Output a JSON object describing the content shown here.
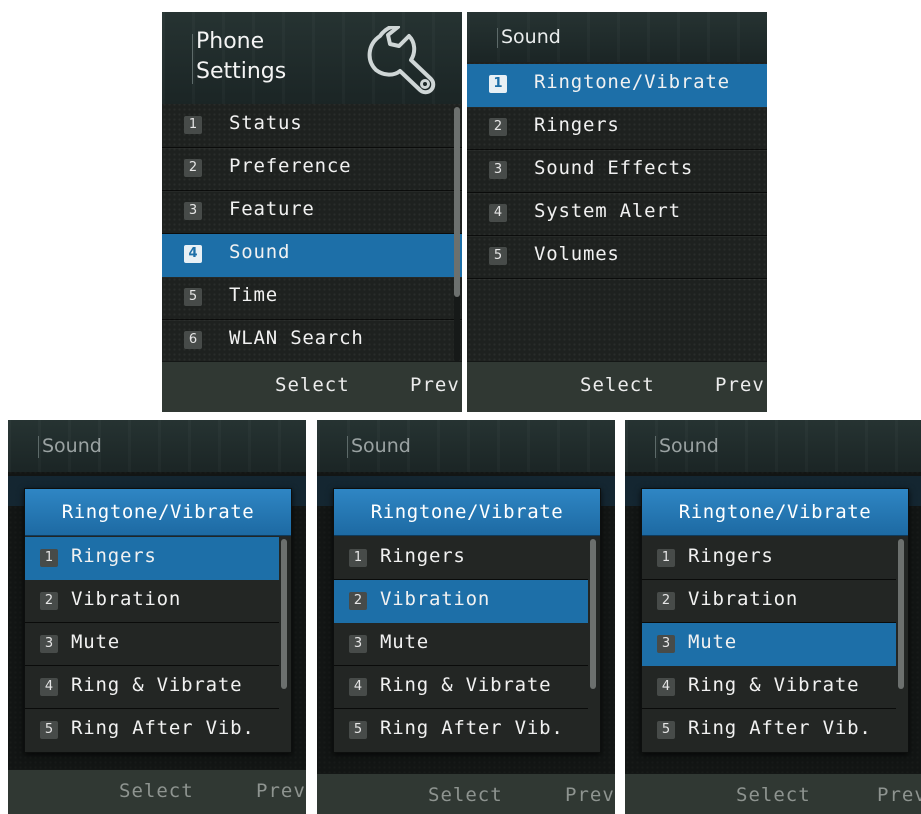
{
  "panel_phone_settings": {
    "title_line1": "Phone",
    "title_line2": "Settings",
    "icon": "wrench-icon",
    "items": [
      {
        "num": "1",
        "label": "Status"
      },
      {
        "num": "2",
        "label": "Preference"
      },
      {
        "num": "3",
        "label": "Feature"
      },
      {
        "num": "4",
        "label": "Sound"
      },
      {
        "num": "5",
        "label": "Time"
      },
      {
        "num": "6",
        "label": "WLAN Search"
      }
    ],
    "selected_index": 3,
    "softkeys": {
      "center": "Select",
      "right": "Prev"
    }
  },
  "panel_sound": {
    "title": "Sound",
    "items": [
      {
        "num": "1",
        "label": "Ringtone/Vibrate"
      },
      {
        "num": "2",
        "label": "Ringers"
      },
      {
        "num": "3",
        "label": "Sound Effects"
      },
      {
        "num": "4",
        "label": "System Alert"
      },
      {
        "num": "5",
        "label": "Volumes"
      }
    ],
    "selected_index": 0,
    "softkeys": {
      "center": "Select",
      "right": "Prev"
    }
  },
  "popup_panels": [
    {
      "title": "Sound",
      "popup_title": "Ringtone/Vibrate",
      "selected_index": 0,
      "softkeys": {
        "center": "Select",
        "right": "Prev"
      }
    },
    {
      "title": "Sound",
      "popup_title": "Ringtone/Vibrate",
      "selected_index": 1,
      "softkeys": {
        "center": "Select",
        "right": "Prev"
      }
    },
    {
      "title": "Sound",
      "popup_title": "Ringtone/Vibrate",
      "selected_index": 2,
      "softkeys": {
        "center": "Select",
        "right": "Prev"
      }
    }
  ],
  "popup_items": [
    {
      "num": "1",
      "label": "Ringers"
    },
    {
      "num": "2",
      "label": "Vibration"
    },
    {
      "num": "3",
      "label": "Mute"
    },
    {
      "num": "4",
      "label": "Ring & Vibrate"
    },
    {
      "num": "5",
      "label": "Ring After Vib."
    }
  ],
  "colors": {
    "highlight": "#1d6fa8",
    "background": "#1e211f",
    "softkey_bar": "#303833"
  }
}
